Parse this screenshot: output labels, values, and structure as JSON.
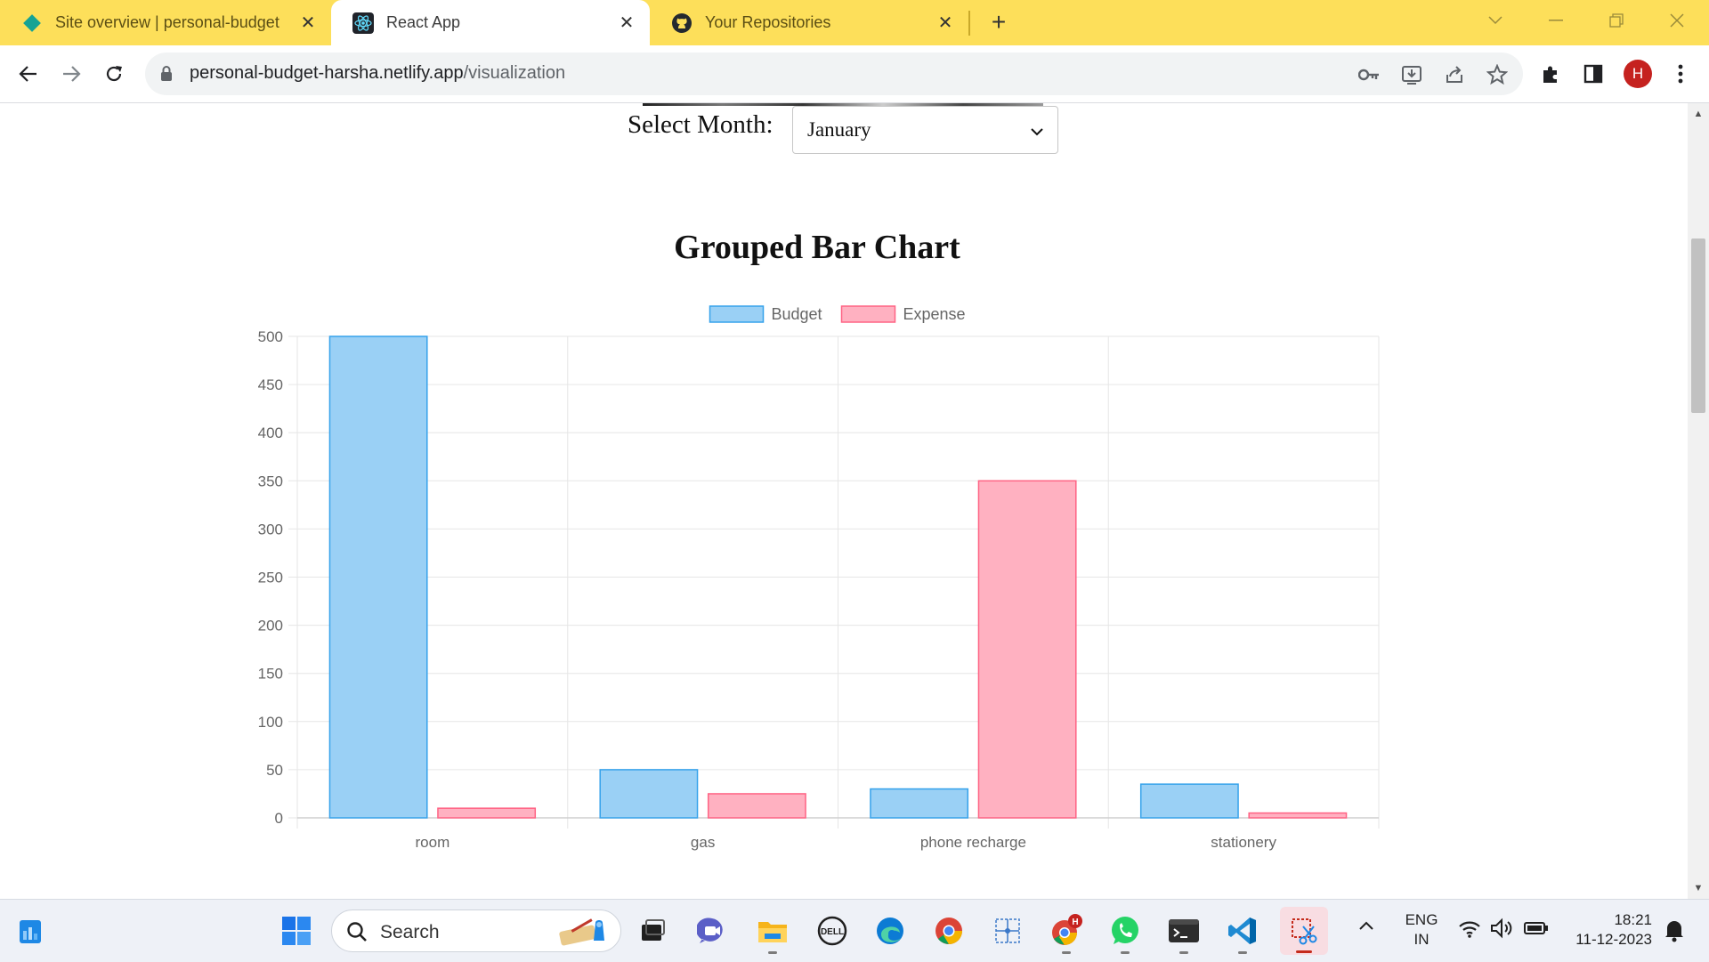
{
  "browser": {
    "tabs": [
      {
        "title": "Site overview | personal-budget",
        "icon": "netlify-diamond-icon",
        "active": false
      },
      {
        "title": "React App",
        "icon": "react-atom-icon",
        "active": true
      },
      {
        "title": "Your Repositories",
        "icon": "github-icon",
        "active": false
      }
    ],
    "url_host": "personal-budget-harsha.netlify.app",
    "url_path": "/visualization",
    "profile_initial": "H",
    "accent": "#fddf5a"
  },
  "page": {
    "month_label": "Select Month:",
    "month_selected": "January"
  },
  "chart_data": {
    "type": "bar",
    "title": "Grouped Bar Chart",
    "categories": [
      "room",
      "gas",
      "phone recharge",
      "stationery"
    ],
    "series": [
      {
        "name": "Budget",
        "values": [
          500,
          50,
          30,
          35
        ],
        "fill": "#9ad0f5",
        "stroke": "#36a2eb"
      },
      {
        "name": "Expense",
        "values": [
          10,
          25,
          350,
          5
        ],
        "fill": "#ffb1c1",
        "stroke": "#ff6384"
      }
    ],
    "ylim": [
      0,
      500
    ],
    "yticks": [
      0,
      50,
      100,
      150,
      200,
      250,
      300,
      350,
      400,
      450,
      500
    ],
    "grid": true,
    "legend": "top"
  },
  "taskbar": {
    "search_placeholder": "Search",
    "apps": [
      "widgets-icon",
      "start-icon",
      "task-view-icon",
      "teams-chat-icon",
      "file-explorer-icon",
      "dell-icon",
      "edge-icon",
      "chrome-icon",
      "snip-grid-icon",
      "chrome-profile-icon",
      "whatsapp-icon",
      "terminal-icon",
      "vscode-icon",
      "snipping-tool-icon"
    ],
    "lang_line1": "ENG",
    "lang_line2": "IN",
    "time": "18:21",
    "date": "11-12-2023"
  }
}
